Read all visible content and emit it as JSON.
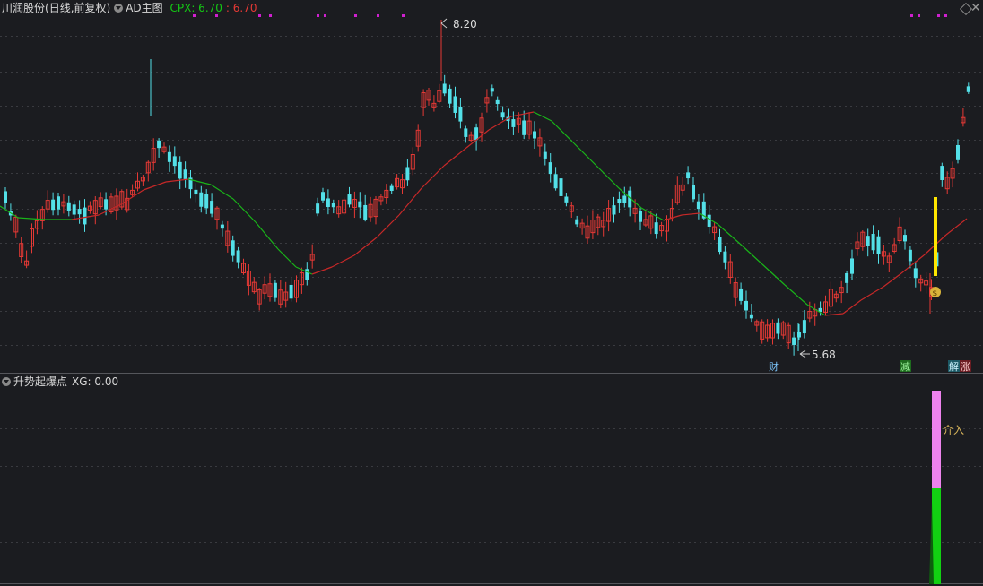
{
  "header": {
    "stock": "川润股份",
    "period": "(日线,前复权)",
    "indicator": "AD主图",
    "cpx_label": "CPX: 6.70",
    "cpx_value": ": 6.70"
  },
  "sub_header": {
    "indicator": "升势起爆点",
    "xg_label": "XG: 0.00"
  },
  "annotations": {
    "high_price": "8.20",
    "low_price": "5.68",
    "event_cai": "财",
    "event_jian": "减",
    "event_jie": "解",
    "event_zhang": "涨",
    "signal_label": "介入",
    "money_bag": "$"
  },
  "colors": {
    "up": "#e53935",
    "down": "#53e0e8",
    "ma_green": "#19b419",
    "ma_red": "#c62828",
    "signal": "#ffe600",
    "pink": "#ee82ee",
    "green_bar": "#12d012",
    "gold": "#d9b43a"
  },
  "chart_data": {
    "type": "candlestick",
    "price_range": [
      5.5,
      8.3
    ],
    "high": 8.2,
    "low": 5.68,
    "close_last": 6.7,
    "moving_average_colors": [
      "green",
      "red"
    ]
  },
  "icons": [
    "dropdown-circle-icon",
    "diamond-icon",
    "close-icon",
    "money-bag-icon"
  ]
}
